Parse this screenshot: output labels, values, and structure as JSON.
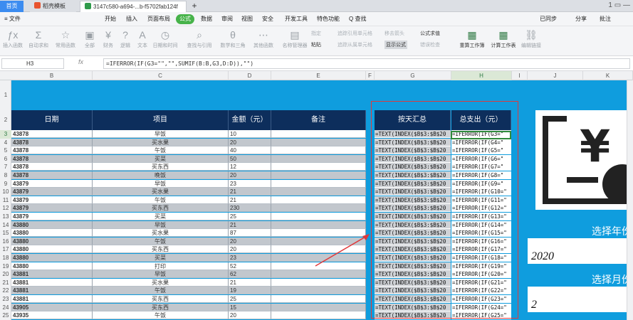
{
  "tabs": {
    "home": "首页",
    "docs": "稻壳模板",
    "file": "3147c580-a694-...b-f5702fab124f",
    "plus": "+"
  },
  "window": {
    "ctrls": "1  ▭  —"
  },
  "menu": {
    "file": "≡ 文件",
    "items": [
      "开始",
      "插入",
      "页面布局",
      "公式",
      "数据",
      "审阅",
      "视图",
      "安全",
      "开发工具",
      "特色功能",
      "Q 查找"
    ],
    "active": "公式",
    "sync": "已同步",
    "share": "分享",
    "comment": "批注"
  },
  "ribbon": {
    "buttons": [
      "插入函数",
      "自动求和",
      "常用函数",
      "全部",
      "财务",
      "逻辑",
      "文本",
      "日期和时间",
      "查找与引用",
      "数学和三角",
      "其他函数",
      "名称管理器"
    ],
    "paste": "粘贴",
    "specify": "指定",
    "trace_prec": "追踪引用单元格",
    "trace_dep": "追踪从属单元格",
    "remove_arrows": "移去箭头",
    "show_formula": "显示公式",
    "eval_formula": "公式求值",
    "error_check": "错误检查",
    "recalc": "重算工作簿",
    "calc_sheet": "计算工作表",
    "edit_links": "编辑链接"
  },
  "formula_bar": {
    "cell_ref": "H3",
    "fx": "fx",
    "formula": "=IFERROR(IF(G3=\"\",\"\",SUMIF(B:B,G3,D:D)),\"\")"
  },
  "columns": [
    "B",
    "C",
    "D",
    "E",
    "F",
    "G",
    "H",
    "I",
    "J",
    "K"
  ],
  "row_numbers": [
    "1",
    "2",
    "3",
    "4",
    "5",
    "6",
    "7",
    "8",
    "9",
    "10",
    "11",
    "12",
    "13",
    "14",
    "15",
    "16",
    "17",
    "18",
    "19",
    "20",
    "21",
    "22",
    "23",
    "24",
    "25"
  ],
  "headers": {
    "date": "日期",
    "item": "项目",
    "amount": "金额（元）",
    "note": "备注",
    "daily_sum": "按天汇总",
    "total": "总支出（元）"
  },
  "rows": [
    {
      "date": "43878",
      "item": "早饭",
      "amount": "10"
    },
    {
      "date": "43878",
      "item": "买水果",
      "amount": "20"
    },
    {
      "date": "43878",
      "item": "午饭",
      "amount": "40"
    },
    {
      "date": "43878",
      "item": "买菜",
      "amount": "50"
    },
    {
      "date": "43878",
      "item": "买东西",
      "amount": "12"
    },
    {
      "date": "43878",
      "item": "晚饭",
      "amount": "20"
    },
    {
      "date": "43879",
      "item": "早饭",
      "amount": "23"
    },
    {
      "date": "43879",
      "item": "买水果",
      "amount": "21"
    },
    {
      "date": "43879",
      "item": "午饭",
      "amount": "21"
    },
    {
      "date": "43879",
      "item": "买东西",
      "amount": "230"
    },
    {
      "date": "43879",
      "item": "买菜",
      "amount": "25"
    },
    {
      "date": "43880",
      "item": "早饭",
      "amount": "21"
    },
    {
      "date": "43880",
      "item": "买水果",
      "amount": "87"
    },
    {
      "date": "43880",
      "item": "午饭",
      "amount": "20"
    },
    {
      "date": "43880",
      "item": "买东西",
      "amount": "20"
    },
    {
      "date": "43880",
      "item": "买菜",
      "amount": "23"
    },
    {
      "date": "43880",
      "item": "打印",
      "amount": "52"
    },
    {
      "date": "43881",
      "item": "早饭",
      "amount": "62"
    },
    {
      "date": "43881",
      "item": "买水果",
      "amount": "21"
    },
    {
      "date": "43881",
      "item": "午饭",
      "amount": "19"
    },
    {
      "date": "43881",
      "item": "买东西",
      "amount": "25"
    },
    {
      "date": "43905",
      "item": "买东西",
      "amount": "15"
    },
    {
      "date": "43935",
      "item": "午饭",
      "amount": "20"
    }
  ],
  "formulas_g": [
    "=TEXT(INDEX($B$3:$B$20",
    "=TEXT(INDEX($B$3:$B$20",
    "=TEXT(INDEX($B$3:$B$20",
    "=TEXT(INDEX($B$3:$B$20",
    "=TEXT(INDEX($B$3:$B$20",
    "=TEXT(INDEX($B$3:$B$20",
    "=TEXT(INDEX($B$3:$B$20",
    "=TEXT(INDEX($B$3:$B$20",
    "=TEXT(INDEX($B$3:$B$20",
    "=TEXT(INDEX($B$3:$B$20",
    "=TEXT(INDEX($B$3:$B$20",
    "=TEXT(INDEX($B$3:$B$20",
    "=TEXT(INDEX($B$3:$B$20",
    "=TEXT(INDEX($B$3:$B$20",
    "=TEXT(INDEX($B$3:$B$20",
    "=TEXT(INDEX($B$3:$B$20",
    "=TEXT(INDEX($B$3:$B$20",
    "=TEXT(INDEX($B$3:$B$20",
    "=TEXT(INDEX($B$3:$B$20",
    "=TEXT(INDEX($B$3:$B$20",
    "=TEXT(INDEX($B$3:$B$20",
    "=TEXT(INDEX($B$3:$B$20",
    "=TEXT(INDEX($B$3:$B$20"
  ],
  "formulas_h": [
    "=IFERROR(IF(G3=\"",
    "=IFERROR(IF(G4=\"",
    "=IFERROR(IF(G5=\"",
    "=IFERROR(IF(G6=\"",
    "=IFERROR(IF(G7=\"",
    "=IFERROR(IF(G8=\"",
    "=IFERROR(IF(G9=\"",
    "=IFERROR(IF(G10=\"",
    "=IFERROR(IF(G11=\"",
    "=IFERROR(IF(G12=\"",
    "=IFERROR(IF(G13=\"",
    "=IFERROR(IF(G14=\"",
    "=IFERROR(IF(G15=\"",
    "=IFERROR(IF(G16=\"",
    "=IFERROR(IF(G17=\"",
    "=IFERROR(IF(G18=\"",
    "=IFERROR(IF(G19=\"",
    "=IFERROR(IF(G20=\"",
    "=IFERROR(IF(G21=\"",
    "=IFERROR(IF(G22=\"",
    "=IFERROR(IF(G23=\"",
    "=IFERROR(IF(G24=\"",
    "=IFERROR(IF(G25=\""
  ],
  "side": {
    "year_label": "选择年份",
    "year_value": "2020",
    "month_label": "选择月份",
    "month_value": "2"
  },
  "colors": {
    "sheet_bg": "#0f9dde",
    "header_bg": "#0d2e5c",
    "accent": "#47b34a",
    "highlight": "#e0393b"
  }
}
